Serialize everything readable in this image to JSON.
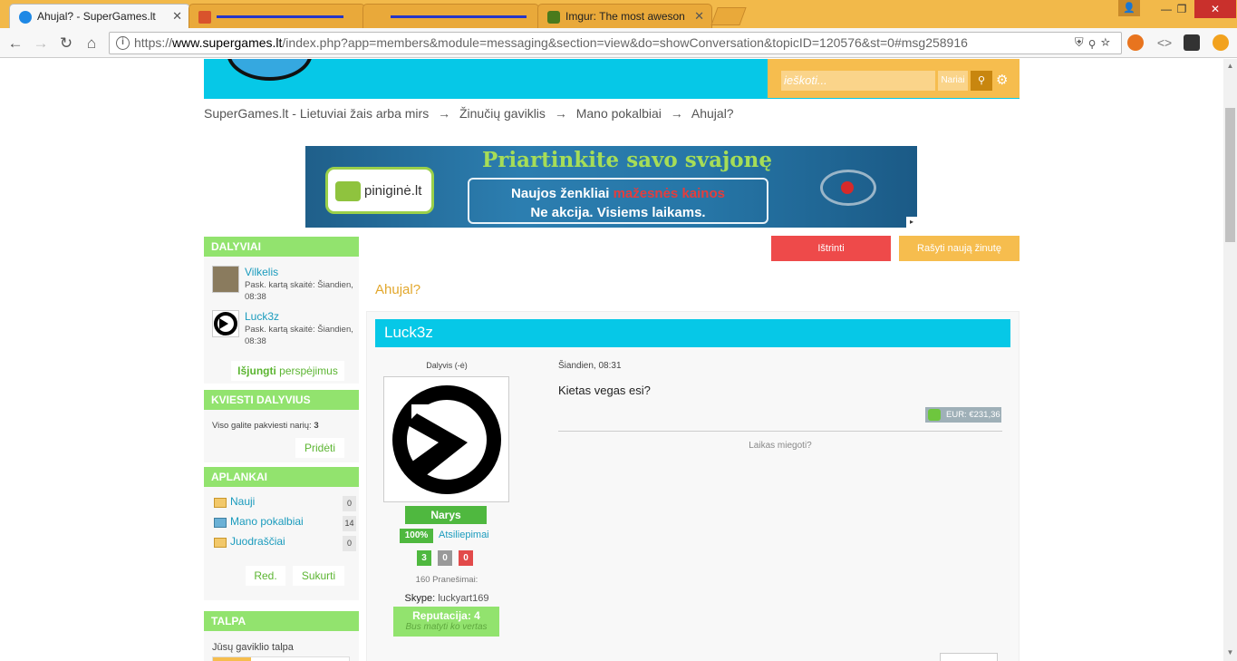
{
  "browser": {
    "tabs": [
      {
        "title": "Ahujal? - SuperGames.lt",
        "active": true
      },
      {
        "title": "",
        "active": false
      },
      {
        "title": "",
        "active": false
      },
      {
        "title": "Imgur: The most aweson",
        "active": false
      }
    ],
    "url_prefix": "https://",
    "url_domain": "www.supergames.lt",
    "url_rest": "/index.php?app=members&module=messaging&section=view&do=showConversation&topicID=120576&st=0#msg258916",
    "accent": "#f2b94a"
  },
  "header": {
    "search_placeholder": "ieškoti...",
    "search_scope": "Nariai"
  },
  "breadcrumb": [
    "SuperGames.lt - Lietuviai žais arba mirs",
    "→",
    "Žinučių gaviklis",
    "→",
    "Mano pokalbiai",
    "→",
    "Ahujal?"
  ],
  "banner": {
    "logo_text": "piniginė.lt",
    "headline": "Priartinkite savo svajonę",
    "line1_prefix": "Naujos ženkliai ",
    "line1_highlight": "mažesnės kainos",
    "line2": "Ne akcija. Visiems laikams."
  },
  "sidebar": {
    "participants_title": "DALYVIAI",
    "participants": [
      {
        "name": "Vilkelis",
        "meta": "Pask. kartą skaitė: Šiandien, 08:38"
      },
      {
        "name": "Luck3z",
        "meta": "Pask. kartą skaitė: Šiandien, 08:38"
      }
    ],
    "notify_bold": "Išjungti",
    "notify_rest": " perspėjimus",
    "invite_title": "KVIESTI DALYVIUS",
    "invite_text": "Viso galite pakviesti narių: ",
    "invite_count": "3",
    "invite_button": "Pridėti",
    "folders_title": "APLANKAI",
    "folders": [
      {
        "name": "Nauji",
        "count": "0"
      },
      {
        "name": "Mano pokalbiai",
        "count": "14"
      },
      {
        "name": "Juodraščiai",
        "count": "0"
      }
    ],
    "edit_button": "Red.",
    "create_button": "Sukurti",
    "storage_title": "TALPA",
    "storage_text": "Jūsų gaviklio talpa"
  },
  "actions": {
    "delete": "Ištrinti",
    "new_message": "Rašyti naują žinutę"
  },
  "conversation": {
    "title": "Ahujal?",
    "post": {
      "author": "Luck3z",
      "role": "Dalyvis (-ė)",
      "group": "Narys",
      "feedback_pct": "100%",
      "feedback_label": "Atsiliepimai",
      "feedback_pos": "3",
      "feedback_neutral": "0",
      "feedback_neg": "0",
      "posts": "160 Pranešimai:",
      "skype_label": "Skype: ",
      "skype_value": "luckyart169",
      "reputation": "Reputacija: 4",
      "reputation_sub": "Bus matyti ko vertas",
      "date": "Šiandien, 08:31",
      "body": "Kietas vegas esi?",
      "balance": "EUR: €231,36",
      "signature": "Laikas miegoti?"
    }
  }
}
